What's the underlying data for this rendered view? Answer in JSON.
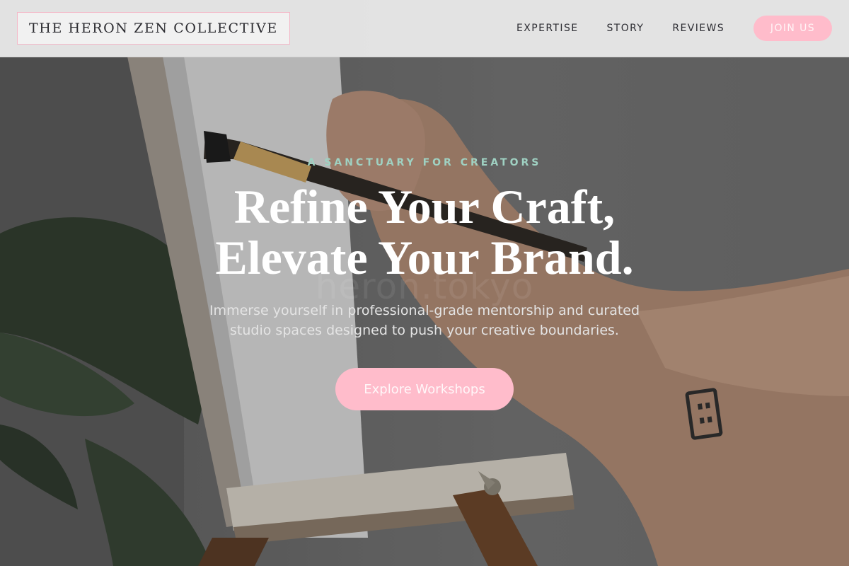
{
  "brand": {
    "name": "THE HERON ZEN COLLECTIVE"
  },
  "nav": {
    "links": [
      "EXPERTISE",
      "STORY",
      "REVIEWS"
    ],
    "join_label": "JOIN US"
  },
  "hero": {
    "eyebrow": "A SANCTUARY FOR CREATORS",
    "headline_line1": "Refine Your Craft,",
    "headline_line2": "Elevate Your Brand.",
    "watermark": "heron.tokyo",
    "subtext": "Immerse yourself in professional-grade mentorship and curated studio spaces designed to push your creative boundaries.",
    "cta_label": "Explore Workshops",
    "background_image": "artist-painting-on-easel"
  },
  "colors": {
    "accent_pink": "#ffbccb",
    "eyebrow_mint": "#9fd1c2",
    "header_bg": "#e8e8e8",
    "logo_border": "#f3b7c7"
  }
}
